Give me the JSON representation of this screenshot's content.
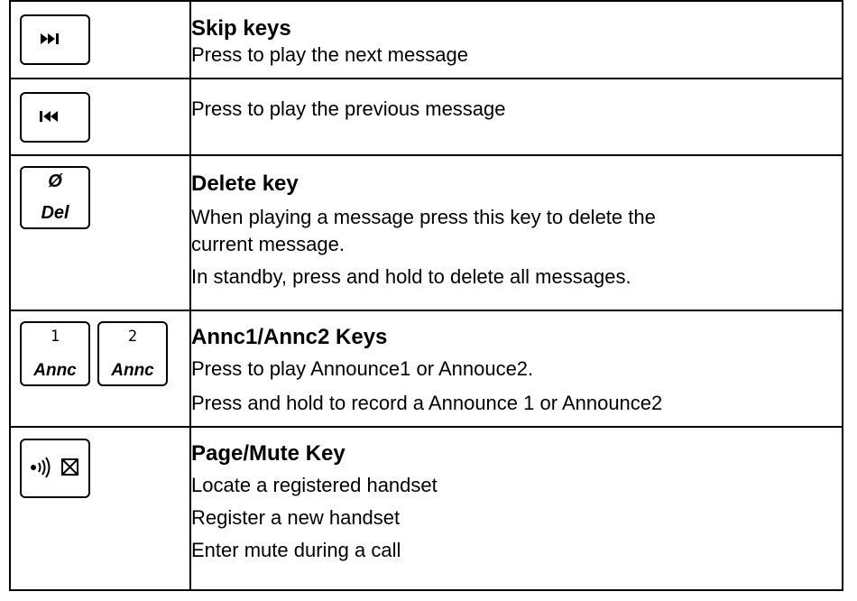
{
  "rows": [
    {
      "title": "Skip keys",
      "lines": [
        "Press to play the next message"
      ],
      "icon": "skip-forward-icon"
    },
    {
      "title": "",
      "lines": [
        "Press to play the previous message"
      ],
      "icon": "skip-back-icon"
    },
    {
      "title": "Delete key",
      "lines": [
        "When playing a message press this key to delete the",
        "current message.",
        "In standby, press and hold to delete all messages."
      ],
      "icon": "delete-icon",
      "key_symbol": "Ø",
      "key_label": "Del"
    },
    {
      "title": "Annc1/Annc2 Keys",
      "lines": [
        "Press to play Announce1 or Annouce2.",
        "Press and hold to record a Announce 1 or Announce2"
      ],
      "keys": [
        {
          "number": "1",
          "label": "Annc"
        },
        {
          "number": "2",
          "label": "Annc"
        }
      ]
    },
    {
      "title": "Page/Mute Key",
      "lines": [
        "Locate a registered handset",
        "Register a new handset",
        "Enter mute during a call"
      ],
      "icon": "page-mute-icon"
    }
  ]
}
